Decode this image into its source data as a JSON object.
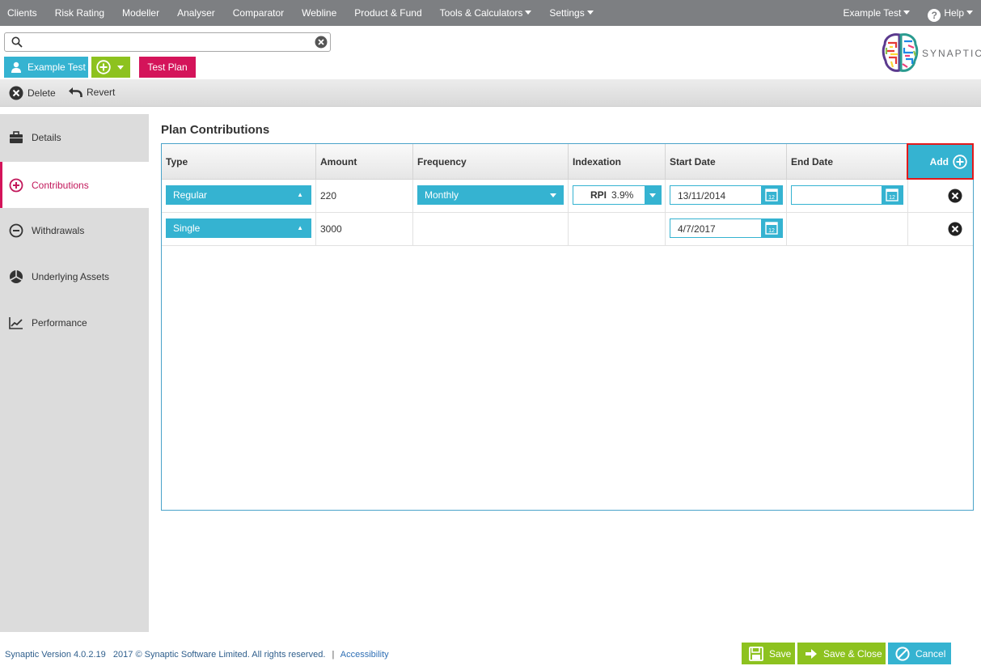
{
  "nav": {
    "items": [
      "Clients",
      "Risk Rating",
      "Modeller",
      "Analyser",
      "Comparator",
      "Webline",
      "Product & Fund",
      "Tools & Calculators",
      "Settings"
    ],
    "user": "Example Test",
    "help": "Help"
  },
  "search": {
    "value": "",
    "placeholder": ""
  },
  "logo": {
    "text": "SYNAPTIC"
  },
  "tabs": {
    "client": "Example Test",
    "plan": "Test Plan"
  },
  "toolbar": {
    "delete": "Delete",
    "revert": "Revert"
  },
  "sidebar": {
    "items": [
      {
        "label": "Details",
        "icon": "briefcase-icon"
      },
      {
        "label": "Contributions",
        "icon": "plus-circle-icon",
        "active": true
      },
      {
        "label": "Withdrawals",
        "icon": "minus-circle-icon"
      },
      {
        "label": "Underlying Assets",
        "icon": "pie-icon"
      },
      {
        "label": "Performance",
        "icon": "line-chart-icon"
      }
    ]
  },
  "main": {
    "title": "Plan Contributions",
    "columns": [
      "Type",
      "Amount",
      "Frequency",
      "Indexation",
      "Start Date",
      "End Date"
    ],
    "add_label": "Add",
    "rows": [
      {
        "type": "Regular",
        "amount": "220",
        "frequency": "Monthly",
        "index_label": "RPI",
        "index_value": "3.9%",
        "start_date": "13/11/2014",
        "end_date": ""
      },
      {
        "type": "Single",
        "amount": "3000",
        "frequency": "",
        "index_label": "",
        "index_value": "",
        "start_date": "4/7/2017",
        "end_date": ""
      }
    ]
  },
  "footer": {
    "version": "Synaptic Version 4.0.2.19",
    "copyright": "2017 © Synaptic Software Limited. All rights reserved.",
    "separator": "|",
    "accessibility": "Accessibility",
    "save": "Save",
    "save_close": "Save & Close",
    "cancel": "Cancel"
  },
  "colors": {
    "nav_bg": "#7d7f82",
    "accent_blue": "#35b3d1",
    "accent_green": "#8dc21f",
    "accent_pink": "#d4145a",
    "highlight_red": "#e3191b"
  }
}
